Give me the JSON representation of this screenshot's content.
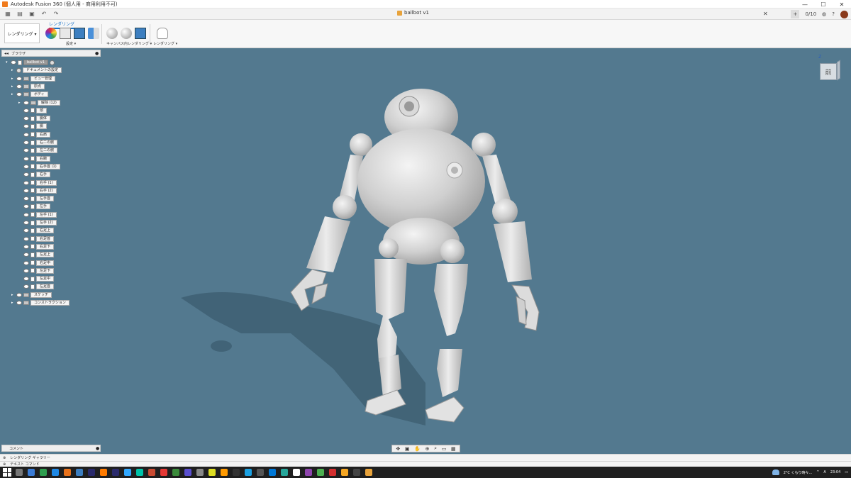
{
  "window": {
    "title": "Autodesk Fusion 360 (個人用 - 商用利用不可)",
    "controls": [
      "—",
      "☐",
      "✕"
    ]
  },
  "tabs": {
    "document": "ballbot v1",
    "right_badge": "0/10",
    "close": "✕"
  },
  "toolbar": {
    "workspace": "レンダリング ▾",
    "ribbon_tab": "レンダリング",
    "groups": [
      {
        "label": "設定 ▾"
      },
      {
        "label": "キャンバス内レンダリング ▾"
      },
      {
        "label": "レンダリング ▾"
      }
    ]
  },
  "browser": {
    "title": "ブラウザ",
    "root": "ballbot v1",
    "items": [
      {
        "label": "ドキュメントの設定",
        "level": 1,
        "icon": "gear"
      },
      {
        "label": "ビュー管理",
        "level": 1,
        "icon": "folder"
      },
      {
        "label": "原点",
        "level": 1,
        "icon": "folder"
      },
      {
        "label": "ボディ",
        "level": 1,
        "icon": "folder"
      },
      {
        "label": "解除 (12)",
        "level": 2,
        "icon": "folder"
      },
      {
        "label": "頭",
        "level": 2,
        "icon": "body"
      },
      {
        "label": "胴体",
        "level": 2,
        "icon": "body"
      },
      {
        "label": "胴",
        "level": 2,
        "icon": "body"
      },
      {
        "label": "右肩",
        "level": 2,
        "icon": "body"
      },
      {
        "label": "右二の腕",
        "level": 2,
        "icon": "body"
      },
      {
        "label": "左二の腕",
        "level": 2,
        "icon": "body"
      },
      {
        "label": "右腕",
        "level": 2,
        "icon": "body"
      },
      {
        "label": "右手首 (1)",
        "level": 2,
        "icon": "body"
      },
      {
        "label": "右手",
        "level": 2,
        "icon": "body"
      },
      {
        "label": "右手 (1)",
        "level": 2,
        "icon": "body"
      },
      {
        "label": "右手 (2)",
        "level": 2,
        "icon": "body"
      },
      {
        "label": "左手首",
        "level": 2,
        "icon": "body"
      },
      {
        "label": "左手",
        "level": 2,
        "icon": "body"
      },
      {
        "label": "左手 (1)",
        "level": 2,
        "icon": "body"
      },
      {
        "label": "左手 (2)",
        "level": 2,
        "icon": "body"
      },
      {
        "label": "右足上",
        "level": 2,
        "icon": "body"
      },
      {
        "label": "右足首",
        "level": 2,
        "icon": "body"
      },
      {
        "label": "右足下",
        "level": 2,
        "icon": "body"
      },
      {
        "label": "左足上",
        "level": 2,
        "icon": "body"
      },
      {
        "label": "右足中",
        "level": 2,
        "icon": "body"
      },
      {
        "label": "左足下",
        "level": 2,
        "icon": "body"
      },
      {
        "label": "左足中",
        "level": 2,
        "icon": "body"
      },
      {
        "label": "左足首",
        "level": 2,
        "icon": "body"
      },
      {
        "label": "スケッチ",
        "level": 1,
        "icon": "folder"
      },
      {
        "label": "コンストラクション",
        "level": 1,
        "icon": "folder"
      }
    ]
  },
  "comments": {
    "label": "コメント"
  },
  "viewcube": {
    "face": "前",
    "axis": "Z"
  },
  "bottom_panels": {
    "gallery": "レンダリング ギャラリー",
    "text_commands": "テキスト コマンド"
  },
  "taskbar": {
    "weather": "2°C くもり時々...",
    "ime": "A",
    "time": "23:04"
  },
  "colors": {
    "viewport_bg": "#53798f",
    "accent": "#1a73c9",
    "taskbar": "#1f1f1f"
  }
}
